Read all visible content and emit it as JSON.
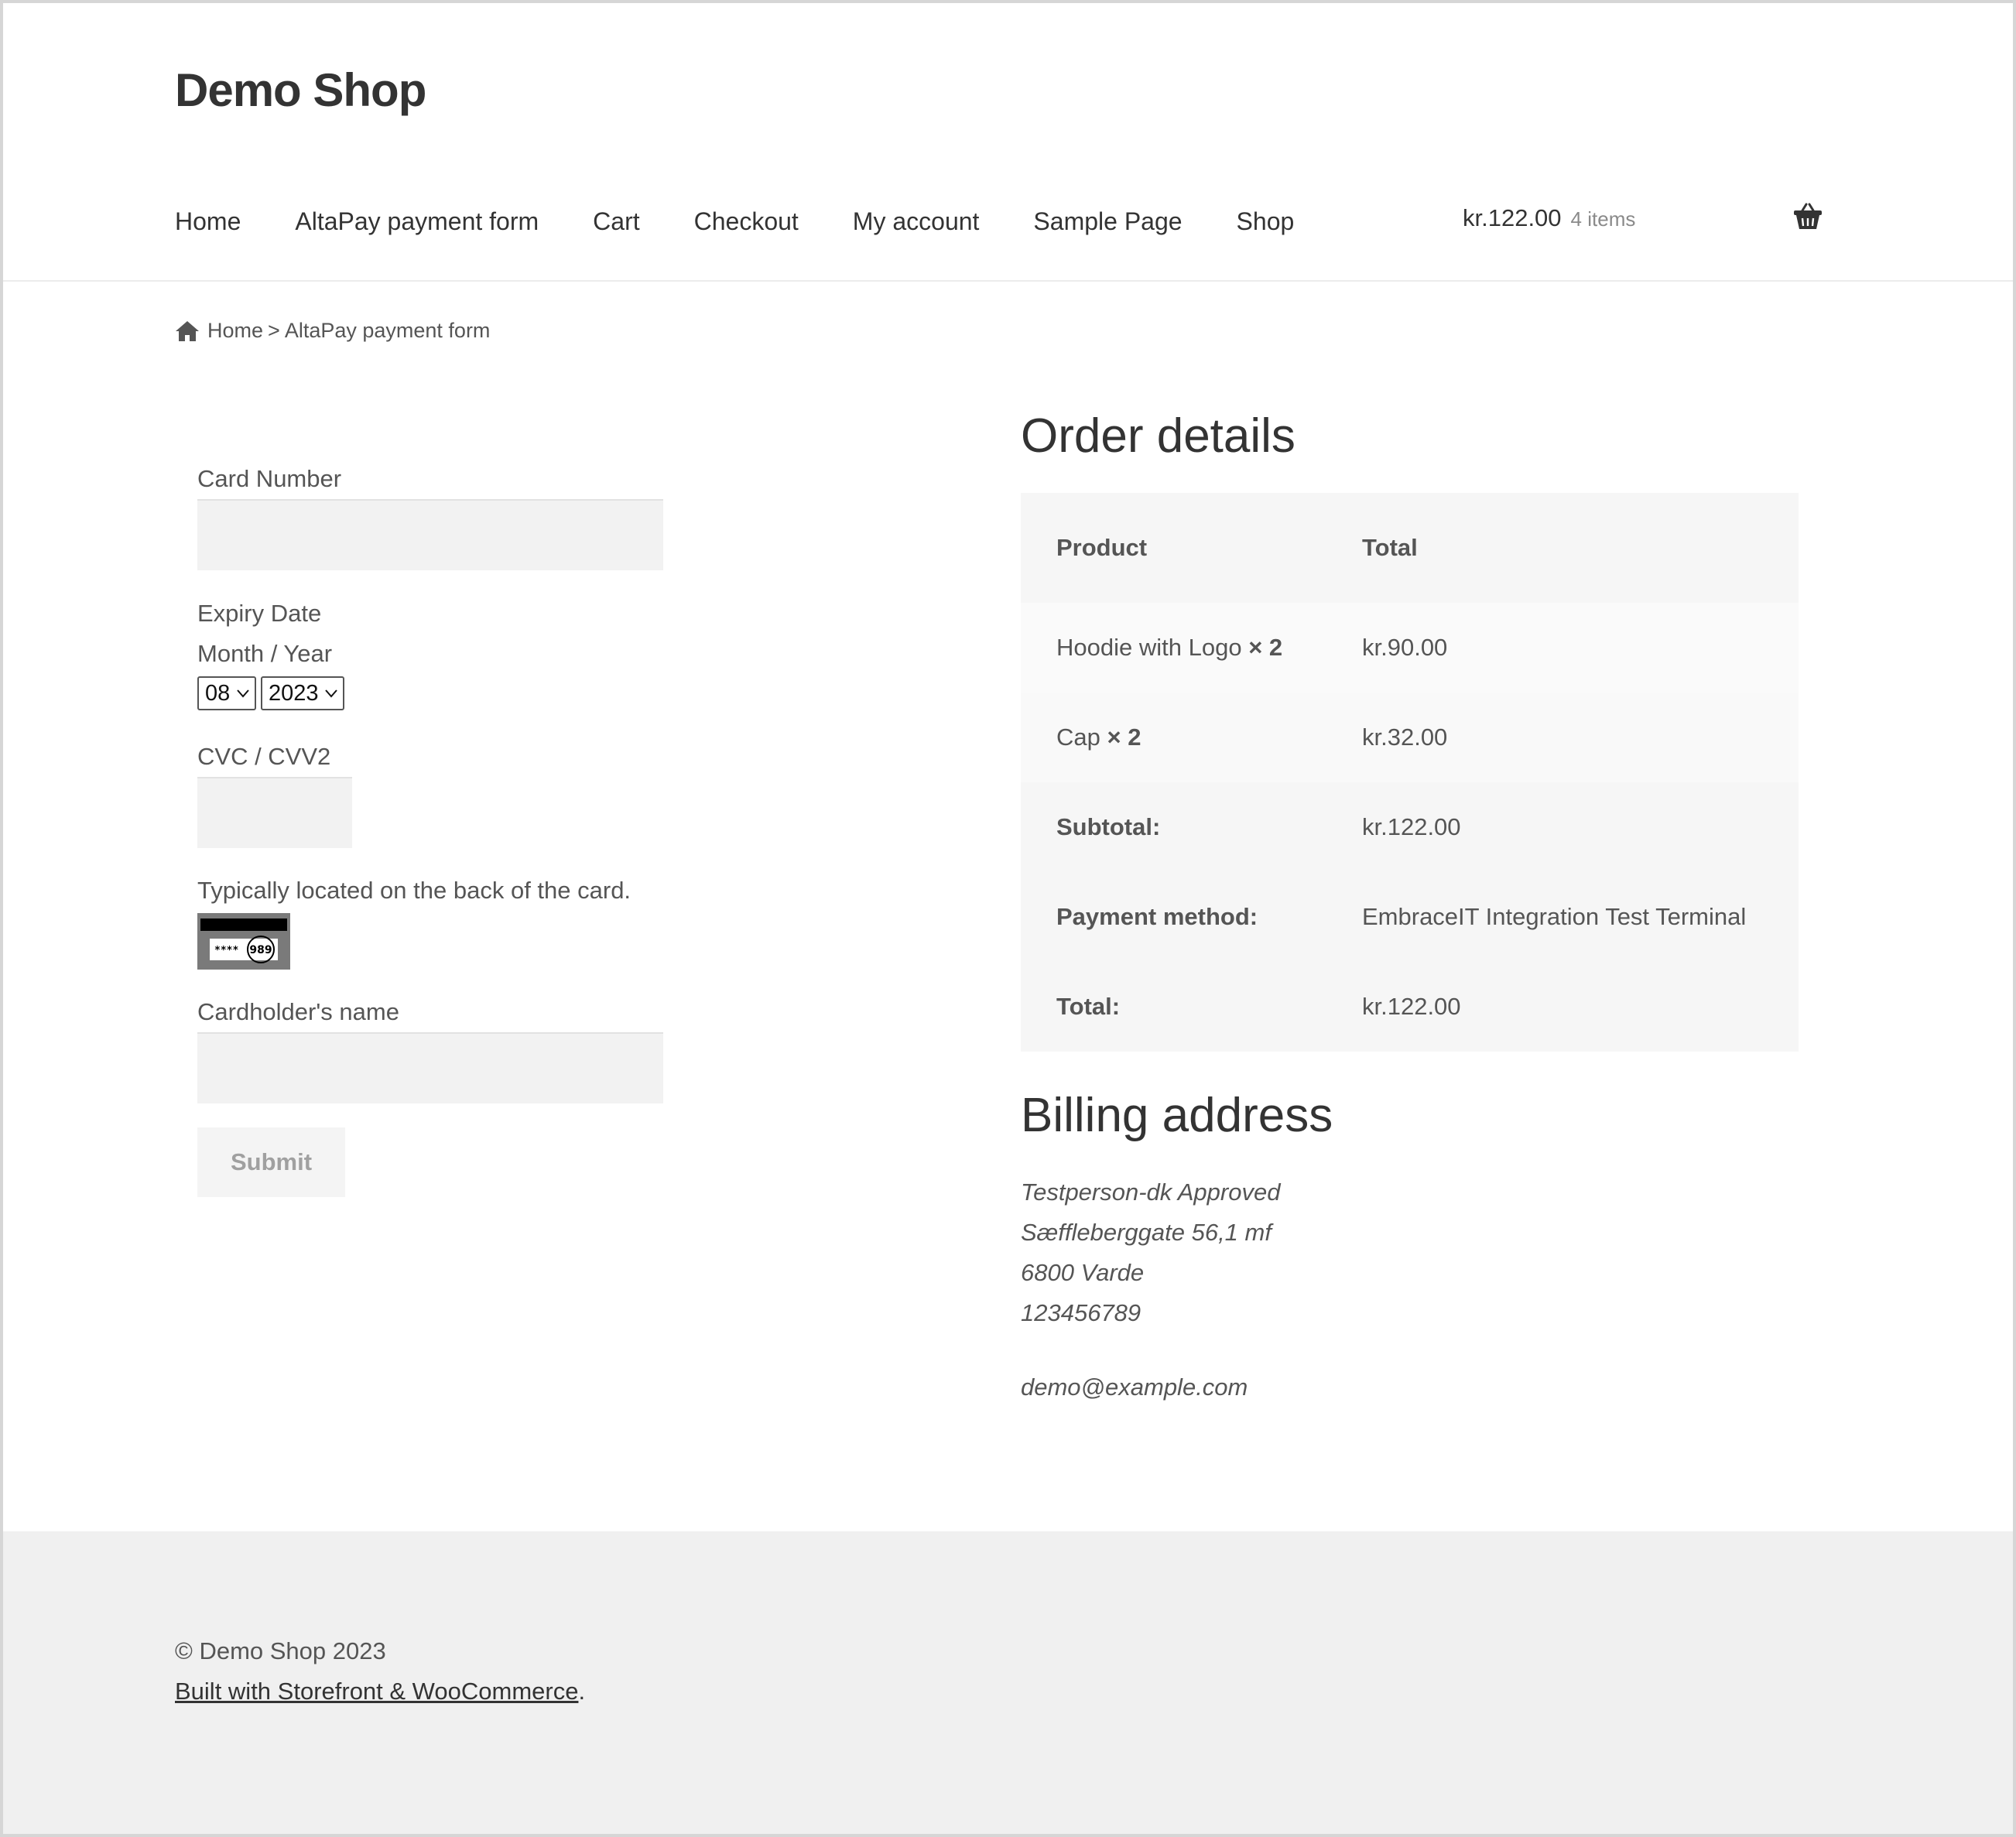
{
  "site": {
    "title": "Demo Shop"
  },
  "nav": {
    "items": [
      {
        "label": "Home"
      },
      {
        "label": "AltaPay payment form"
      },
      {
        "label": "Cart"
      },
      {
        "label": "Checkout"
      },
      {
        "label": "My account"
      },
      {
        "label": "Sample Page"
      },
      {
        "label": "Shop"
      }
    ]
  },
  "cart": {
    "total": "kr.122.00",
    "count": "4 items",
    "icon": "basket-icon"
  },
  "breadcrumb": {
    "home_icon": "home-icon",
    "home": "Home",
    "separator": ">",
    "current": "AltaPay payment form"
  },
  "payment_form": {
    "card_number_label": "Card Number",
    "card_number_value": "",
    "expiry_label": "Expiry Date",
    "month_year_label": "Month / Year",
    "month_value": "08",
    "year_value": "2023",
    "cvc_label": "CVC / CVV2",
    "cvc_value": "",
    "cvc_hint": "Typically located on the back of the card.",
    "cvc_image_text": "****",
    "cvc_image_digits": "989",
    "cardholder_label": "Cardholder's name",
    "cardholder_value": "",
    "submit_label": "Submit"
  },
  "order": {
    "title": "Order details",
    "headers": {
      "product": "Product",
      "total": "Total"
    },
    "items": [
      {
        "name": "Hoodie with Logo",
        "qty": "× 2",
        "total": "kr.90.00"
      },
      {
        "name": "Cap",
        "qty": "× 2",
        "total": "kr.32.00"
      }
    ],
    "summary": [
      {
        "label": "Subtotal:",
        "value": "kr.122.00"
      },
      {
        "label": "Payment method:",
        "value": "EmbraceIT Integration Test Terminal"
      },
      {
        "label": "Total:",
        "value": "kr.122.00"
      }
    ]
  },
  "billing": {
    "title": "Billing address",
    "name": "Testperson-dk Approved",
    "street": "Sæffleberggate 56,1 mf",
    "city": "6800 Varde",
    "phone": "123456789",
    "email": "demo@example.com"
  },
  "footer": {
    "copyright": "© Demo Shop 2023",
    "built_with": "Built with Storefront & WooCommerce",
    "period": "."
  }
}
